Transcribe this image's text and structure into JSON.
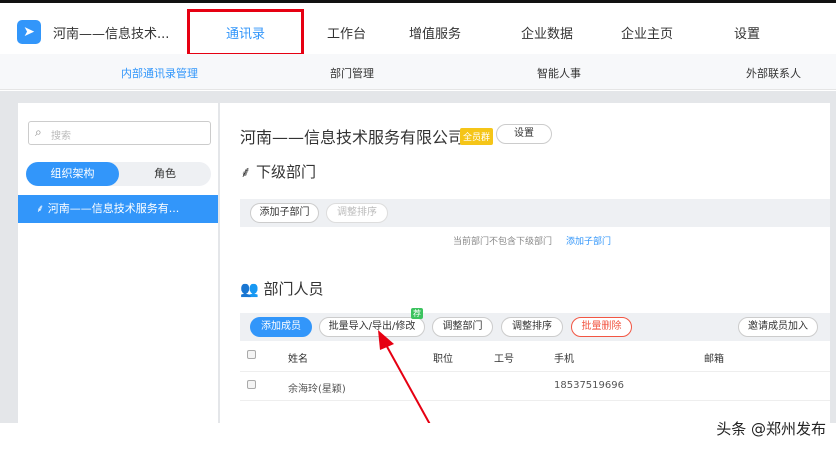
{
  "header": {
    "org": "河南——信息技术...",
    "nav": [
      "通讯录",
      "工作台",
      "增值服务",
      "企业数据",
      "企业主页",
      "设置"
    ]
  },
  "subnav": [
    "内部通讯录管理",
    "部门管理",
    "智能人事",
    "外部联系人"
  ],
  "sidebar": {
    "search_placeholder": "搜索",
    "tabs": [
      "组织架构",
      "角色"
    ],
    "tree_item": "河南——信息技术服务有..."
  },
  "main": {
    "company": "河南——信息技术服务有限公司",
    "badge": "全员群",
    "settings": "设置",
    "sub_dept_title": "下级部门",
    "add_sub": "添加子部门",
    "reorder": "调整排序",
    "empty_note": "当前部门不包含下级部门",
    "empty_link": "添加子部门",
    "members_title": "部门人员",
    "add_member": "添加成员",
    "batch": "批量导入/导出/修改",
    "batch_badge": "荐",
    "adjust_dept": "调整部门",
    "adjust_order": "调整排序",
    "batch_delete": "批量删除",
    "invite": "邀请成员加入",
    "columns": [
      "姓名",
      "职位",
      "工号",
      "手机",
      "邮箱"
    ],
    "rows": [
      {
        "name": "余海玲(星颖)",
        "phone": "18537519696"
      }
    ]
  },
  "watermark": "头条 @郑州发布"
}
